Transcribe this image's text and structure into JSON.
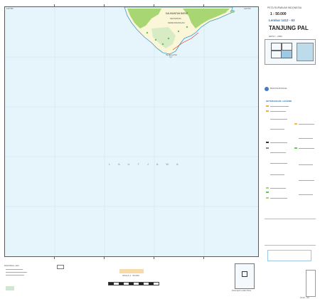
{
  "header": {
    "series": "PETA RUPABUMI INDONESIA",
    "scale": "1 : 50.000",
    "sheet": "Lembar 1412 - 63",
    "title": "TANJUNG PAL",
    "edition": "EDISI I - 2000"
  },
  "map": {
    "sea_label": "L A U T   J A W A",
    "land_labels": [
      "KALIMANTAN BARAT",
      "KETAPANG",
      "KENDAWANGAN"
    ],
    "place_label": "Tanjung Pal",
    "corner_top_left": "110°00'",
    "corner_top_right": "110°15'",
    "colors": {
      "sea": "#e6f4fb",
      "land": "#fbf6d8",
      "vegetation": "#a8d672",
      "swamp": "#6bbf63",
      "coast": "#3c9ad0"
    }
  },
  "legend": {
    "heading": "KETERANGAN / LEGEND",
    "agency": "BAKOSURTANAL",
    "scale_bar": "SKALA 1 : 50.000"
  },
  "footer": {
    "left_note": "Diterbitkan oleh",
    "index_label": "Petunjuk Letak Peta",
    "sheet_bottom": "1412 - 63"
  }
}
